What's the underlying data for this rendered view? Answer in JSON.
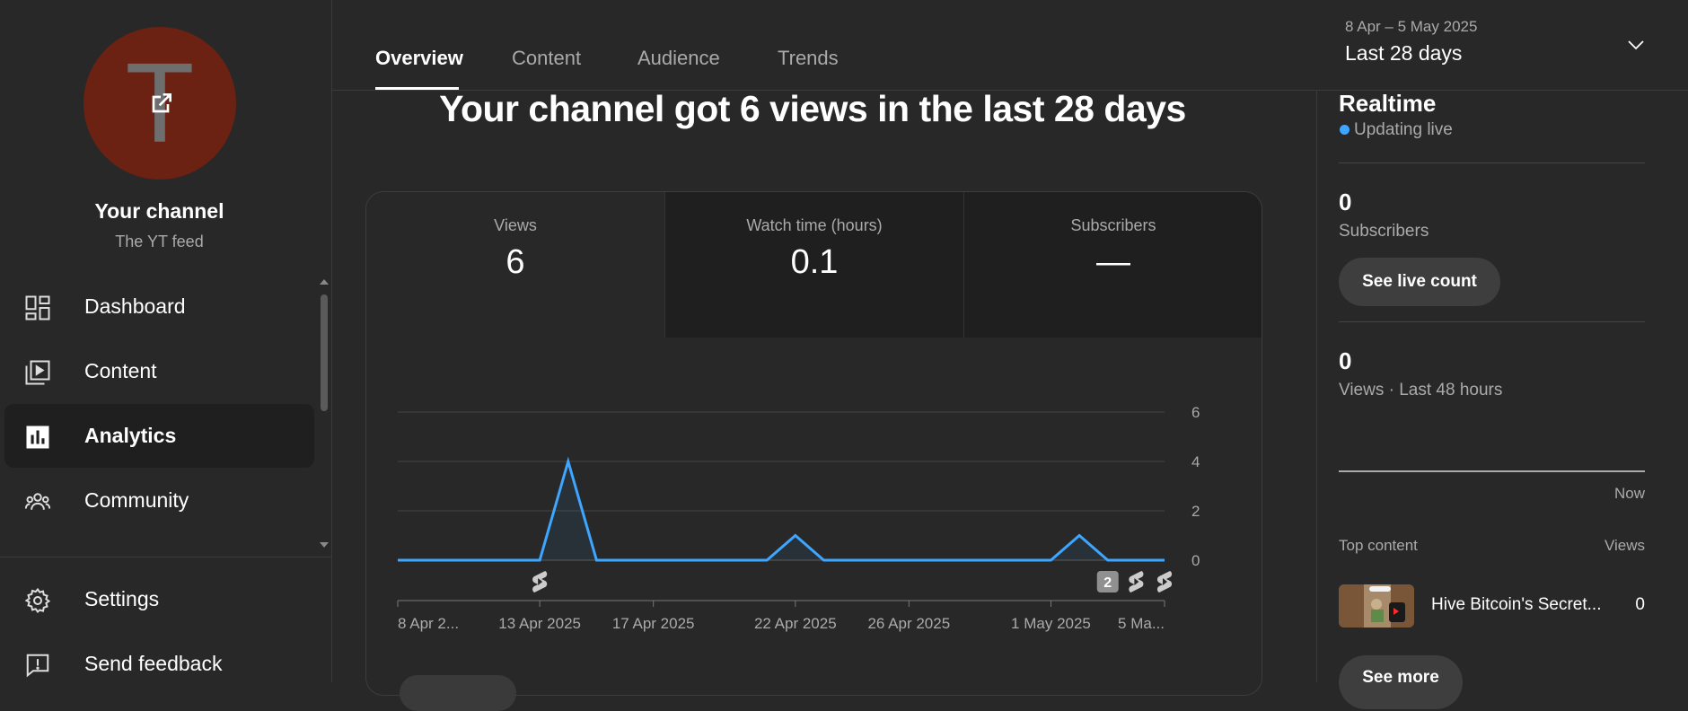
{
  "sidebar": {
    "avatar_letter": "T",
    "channel_title": "Your channel",
    "channel_subtitle": "The YT feed",
    "nav": [
      {
        "label": "Dashboard",
        "icon": "dashboard-icon"
      },
      {
        "label": "Content",
        "icon": "content-icon"
      },
      {
        "label": "Analytics",
        "icon": "analytics-icon",
        "active": true
      },
      {
        "label": "Community",
        "icon": "community-icon"
      }
    ],
    "footer": [
      {
        "label": "Settings",
        "icon": "gear-icon"
      },
      {
        "label": "Send feedback",
        "icon": "feedback-icon"
      }
    ]
  },
  "tabs": [
    {
      "label": "Overview",
      "active": true
    },
    {
      "label": "Content"
    },
    {
      "label": "Audience"
    },
    {
      "label": "Trends"
    }
  ],
  "date_picker": {
    "range": "8 Apr – 5 May 2025",
    "period": "Last 28 days"
  },
  "headline": "Your channel got 6 views in the last 28 days",
  "metrics": [
    {
      "label": "Views",
      "value": "6"
    },
    {
      "label": "Watch time (hours)",
      "value": "0.1"
    },
    {
      "label": "Subscribers",
      "value": "—"
    }
  ],
  "chart_data": {
    "type": "line",
    "x": [
      "8 Apr",
      "9 Apr",
      "10 Apr",
      "11 Apr",
      "12 Apr",
      "13 Apr",
      "14 Apr",
      "15 Apr",
      "16 Apr",
      "17 Apr",
      "18 Apr",
      "19 Apr",
      "20 Apr",
      "21 Apr",
      "22 Apr",
      "23 Apr",
      "24 Apr",
      "25 Apr",
      "26 Apr",
      "27 Apr",
      "28 Apr",
      "29 Apr",
      "30 Apr",
      "1 May",
      "2 May",
      "3 May",
      "4 May",
      "5 May"
    ],
    "series": [
      {
        "values": [
          0,
          0,
          0,
          0,
          0,
          0,
          4,
          0,
          0,
          0,
          0,
          0,
          0,
          0,
          1,
          0,
          0,
          0,
          0,
          0,
          0,
          0,
          0,
          0,
          1,
          0,
          0,
          0
        ]
      }
    ],
    "x_tick_labels": [
      "8 Apr 2...",
      "13 Apr 2025",
      "17 Apr 2025",
      "22 Apr 2025",
      "26 Apr 2025",
      "1 May 2025",
      "5 Ma..."
    ],
    "y_ticks": [
      0,
      2,
      4,
      6
    ],
    "ylim": [
      0,
      6
    ],
    "grid": true,
    "y_axis_side": "right",
    "line_color": "#3ea6ff",
    "markers": [
      {
        "day": "13 Apr",
        "icon": "shorts-icon"
      },
      {
        "day": "3 May",
        "icon": "badge",
        "label": "2"
      },
      {
        "day": "4 May",
        "icon": "shorts-icon"
      },
      {
        "day": "5 May",
        "icon": "shorts-icon"
      }
    ]
  },
  "realtime": {
    "title": "Realtime",
    "status": "Updating live",
    "subscribers_value": "0",
    "subscribers_label": "Subscribers",
    "live_count_button": "See live count",
    "views_value": "0",
    "views_label": "Views · Last 48 hours",
    "now_label": "Now",
    "top_content_header": "Top content",
    "views_header": "Views",
    "top_item": {
      "title": "Hive Bitcoin's Secret...",
      "views": "0"
    },
    "see_more_button": "See more"
  },
  "colors": {
    "background": "#282828",
    "accent": "#3ea6ff",
    "avatar": "#6b2212"
  }
}
